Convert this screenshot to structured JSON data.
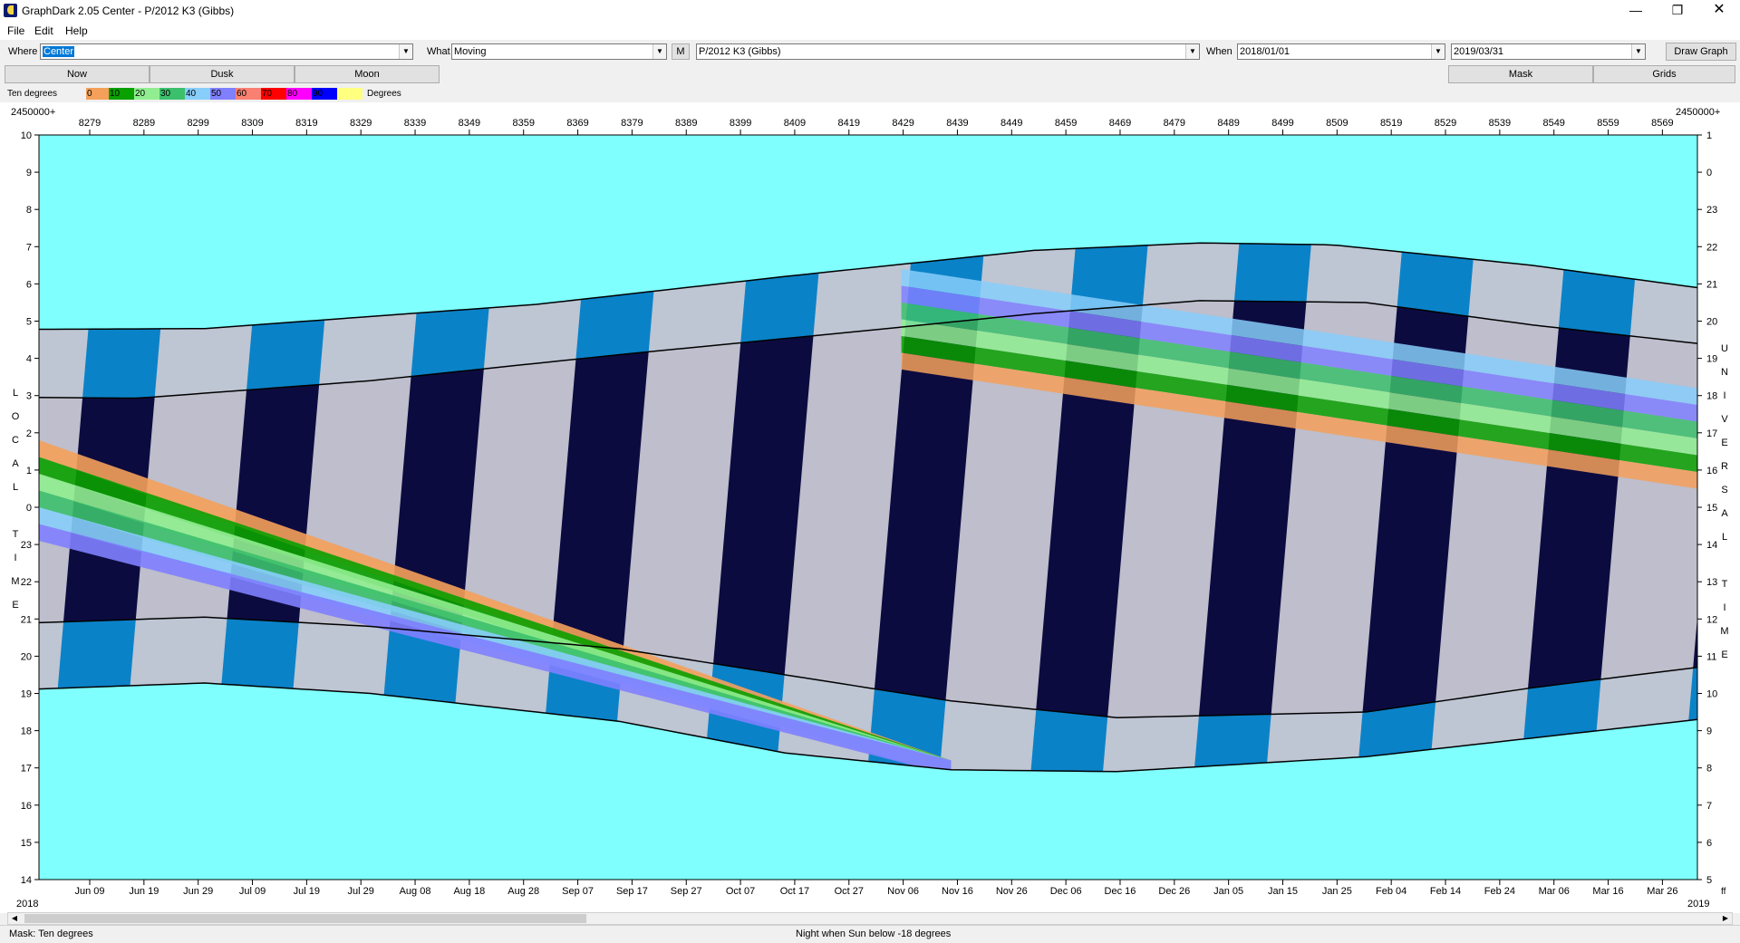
{
  "window": {
    "title": "GraphDark 2.05  Center  -  P/2012 K3 (Gibbs)"
  },
  "menu": [
    "File",
    "Edit",
    "Help"
  ],
  "toolbar": {
    "where_label": "Where",
    "where_value": "Center",
    "what_label": "What",
    "what_value": "Moving",
    "m_button": "M",
    "object_value": "P/2012 K3 (Gibbs)",
    "when_label": "When",
    "start_date": "2018/01/01",
    "end_date": "2019/03/31",
    "draw_button": "Draw Graph"
  },
  "buttons": {
    "now": "Now",
    "dusk": "Dusk",
    "moon": "Moon",
    "mask": "Mask",
    "grids": "Grids"
  },
  "legend": {
    "label": "Ten degrees",
    "unit": "Degrees",
    "items": [
      {
        "text": "0",
        "color": "#f4a05a"
      },
      {
        "text": "10",
        "color": "#0aa000"
      },
      {
        "text": "20",
        "color": "#90ee90"
      },
      {
        "text": "30",
        "color": "#3cc06c"
      },
      {
        "text": "40",
        "color": "#87cefa"
      },
      {
        "text": "50",
        "color": "#8080ff"
      },
      {
        "text": "60",
        "color": "#fa8072"
      },
      {
        "text": "70",
        "color": "#ff0000"
      },
      {
        "text": "80",
        "color": "#ff00ff"
      },
      {
        "text": "90",
        "color": "#0000ff"
      },
      {
        "text": "",
        "color": "#ffff80"
      }
    ]
  },
  "graph": {
    "jd_offset_label": "2450000+",
    "jd_ticks": [
      "8279",
      "8289",
      "8299",
      "8309",
      "8319",
      "8329",
      "8339",
      "8349",
      "8359",
      "8369",
      "8379",
      "8389",
      "8399",
      "8409",
      "8419",
      "8429",
      "8439",
      "8449",
      "8459",
      "8469",
      "8479",
      "8489",
      "8499",
      "8509",
      "8519",
      "8529",
      "8539",
      "8549",
      "8559",
      "8569"
    ],
    "date_ticks": [
      "Jun 09",
      "Jun 19",
      "Jun 29",
      "Jul 09",
      "Jul 19",
      "Jul 29",
      "Aug 08",
      "Aug 18",
      "Aug 28",
      "Sep 07",
      "Sep 17",
      "Sep 27",
      "Oct 07",
      "Oct 17",
      "Oct 27",
      "Nov 06",
      "Nov 16",
      "Nov 26",
      "Dec 06",
      "Dec 16",
      "Dec 26",
      "Jan 05",
      "Jan 15",
      "Jan 25",
      "Feb 04",
      "Feb 14",
      "Feb 24",
      "Mar 06",
      "Mar 16",
      "Mar 26"
    ],
    "year_left": "2018",
    "year_right": "2019",
    "local_ticks": [
      "10",
      "9",
      "8",
      "7",
      "6",
      "5",
      "4",
      "3",
      "2",
      "1",
      "0",
      "23",
      "22",
      "21",
      "20",
      "19",
      "18",
      "17",
      "16",
      "15",
      "14"
    ],
    "universal_ticks": [
      "1",
      "0",
      "23",
      "22",
      "21",
      "20",
      "19",
      "18",
      "17",
      "16",
      "15",
      "14",
      "13",
      "12",
      "11",
      "10",
      "9",
      "8",
      "7",
      "6",
      "5"
    ],
    "left_axis_title": "LOCAL TIME",
    "right_axis_title": "UNIVERSAL TIME",
    "corner_right": "ff",
    "colors": {
      "day": "#80ffff",
      "night": "#0c0b40",
      "moon": "#c8c8d4",
      "twilight": "#0a82c8"
    }
  },
  "status": {
    "mask": "Mask:  Ten degrees",
    "night": "Night when Sun below -18 degrees"
  }
}
